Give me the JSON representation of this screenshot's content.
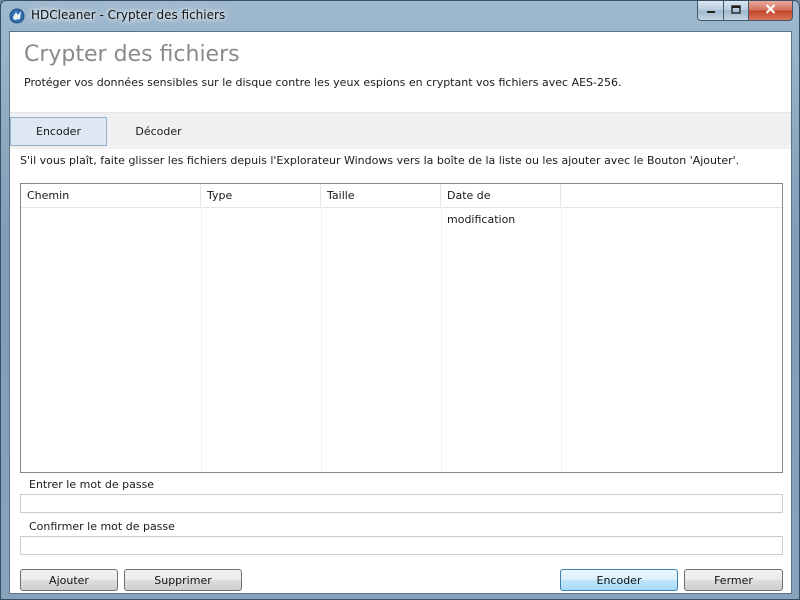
{
  "window": {
    "title": "HDCleaner - Crypter des fichiers"
  },
  "header": {
    "title": "Crypter des fichiers",
    "subtitle": "Protéger vos données sensibles sur le disque contre les yeux espions en cryptant vos fichiers avec AES-256."
  },
  "tabs": [
    {
      "label": "Encoder",
      "active": true
    },
    {
      "label": "Décoder",
      "active": false
    }
  ],
  "instructions": "S'il vous plaît, faite glisser les fichiers depuis l'Explorateur Windows vers la boîte de la liste ou les ajouter avec le Bouton 'Ajouter'.",
  "file_list": {
    "columns": [
      "Chemin",
      "Type",
      "Taille",
      "Date de modification"
    ],
    "rows": []
  },
  "password": {
    "label": "Entrer le mot de passe",
    "value": "",
    "confirm_label": "Confirmer le mot de passe",
    "confirm_value": ""
  },
  "buttons": {
    "add": "Ajouter",
    "remove": "Supprimer",
    "encode": "Encoder",
    "close": "Fermer"
  },
  "icons": {
    "app": "hdcleaner-app-icon",
    "minimize": "minimize-icon",
    "maximize": "maximize-icon",
    "close": "close-icon"
  },
  "colors": {
    "active_tab": "#dde8f3",
    "title_text": "#8a8a8a",
    "close_button": "#c2422a"
  }
}
